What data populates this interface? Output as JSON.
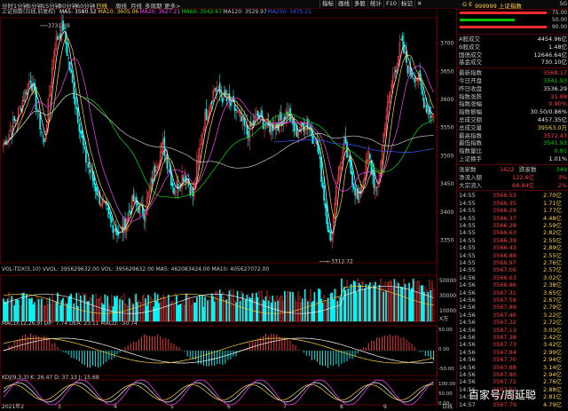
{
  "topbar": {
    "tabs": [
      "分时",
      "1分钟",
      "5分钟",
      "15分钟",
      "30分钟",
      "60分钟",
      "日线",
      "周线",
      "月线",
      "多周期",
      "更多>"
    ],
    "active_tab": "日线",
    "right_tabs": [
      "指标",
      "画线",
      "多股",
      "统计",
      "F10",
      "标记",
      "✕"
    ]
  },
  "main": {
    "title": "上证指数(日线,前复权)",
    "ma": [
      {
        "label": "MA5: 3580.52",
        "color": "#ffffff"
      },
      {
        "label": "MA10: 3605.06",
        "color": "#ffd23c"
      },
      {
        "label": "MA20: 3627.21",
        "color": "#ff40ff"
      },
      {
        "label": "MA60: 3542.67",
        "color": "#00e000"
      },
      {
        "label": "MA120: 3529.97",
        "color": "#c8c8c8"
      },
      {
        "label": "MA250: 3475.21",
        "color": "#3c5aff"
      }
    ],
    "price_ticks": [
      "3700",
      "3650",
      "3600",
      "3550",
      "3500",
      "3450",
      "3400",
      "3350"
    ],
    "high_label": "3731.69",
    "low_label": "3312.72"
  },
  "vol": {
    "header": "VOL-TDX(5,10)  VVOL: 395629632.00  VOL: 395629632.00  MA5: 462083424.00  MA10: 405627072.00",
    "ticks": [
      "50000",
      "30000",
      "10000"
    ],
    "unit": "X万"
  },
  "macd": {
    "header": "MACD(12,26,9)  DIF: 7.74  DEA: 23.11  MACD: -30.74",
    "ticks": [
      "50.00",
      "0.00",
      "-50.00"
    ]
  },
  "kdj": {
    "header": "KDJ(9,3,3)  K: 26.47  D: 37.13  J: 15.68",
    "ticks": [
      "100.00",
      "50.00",
      "0.00"
    ]
  },
  "date_axis": [
    "2021年2",
    "3",
    "4",
    "5",
    "6",
    "7",
    "8",
    "9",
    "日线"
  ],
  "right": {
    "header": "999999 上证指数",
    "code_prefix": "G E",
    "side_tag": "SG",
    "bar_values": [
      "75.00",
      "50.00",
      "90.00"
    ],
    "rows1": [
      {
        "label": "A股成交",
        "value": "4454.96亿",
        "cls": "wht"
      },
      {
        "label": "B股成交",
        "value": "1.48亿",
        "cls": "wht"
      },
      {
        "label": "国债成交",
        "value": "12646.64亿",
        "cls": "wht"
      },
      {
        "label": "基金成交",
        "value": "730.10亿",
        "cls": "wht"
      }
    ],
    "rows2": [
      {
        "label": "最新指数",
        "value": "3568.17",
        "cls": "red"
      },
      {
        "label": "今日开盘",
        "value": "3541.93",
        "cls": "grn"
      },
      {
        "label": "昨日收盘",
        "value": "3536.29",
        "cls": "wht"
      },
      {
        "label": "指数涨跌",
        "value": "31.88",
        "cls": "red"
      },
      {
        "label": "指数涨幅",
        "value": "0.90%",
        "cls": "red"
      },
      {
        "label": "指数振幅",
        "value": "30.50/0.86%",
        "cls": "wht"
      },
      {
        "label": "总成交额",
        "value": "4457.35亿",
        "cls": "wht"
      },
      {
        "label": "总成交量",
        "value": "39563.0万",
        "cls": "ylw"
      },
      {
        "label": "最高指数",
        "value": "3572.43",
        "cls": "red"
      },
      {
        "label": "最低指数",
        "value": "3541.93",
        "cls": "grn"
      },
      {
        "label": "指数量比",
        "value": "0.81",
        "cls": "grn"
      },
      {
        "label": "上证换手",
        "value": "1.01%",
        "cls": "wht"
      }
    ],
    "updown": {
      "up_label": "涨家数",
      "up": "1622",
      "down_label": "跌家数",
      "down": "349"
    },
    "flows": [
      {
        "label": "净流入额",
        "value": "122.6亿",
        "pct": "3%"
      },
      {
        "label": "大宗流入",
        "value": "68.84亿",
        "pct": "2%"
      }
    ],
    "ticks": [
      [
        "14:55",
        "3566.53",
        "2.70亿"
      ],
      [
        "14:55",
        "3566.35",
        "1.71亿"
      ],
      [
        "14:55",
        "3566.29",
        "1.77亿"
      ],
      [
        "14:55",
        "3566.37",
        "4.48亿"
      ],
      [
        "14:55",
        "3566.28",
        "2.59亿"
      ],
      [
        "14:55",
        "3566.63",
        "2.82亿"
      ],
      [
        "14:55",
        "3566.39",
        "2.55亿"
      ],
      [
        "14:55",
        "3566.43",
        "2.89亿"
      ],
      [
        "14:55",
        "3566.88",
        "2.55亿"
      ],
      [
        "14:55",
        "3566.97",
        "2.76亿"
      ],
      [
        "14:55",
        "3567.06",
        "2.57亿"
      ],
      [
        "14:56",
        "3566.63",
        "3.02亿"
      ],
      [
        "14:56",
        "3566.86",
        "2.38亿"
      ],
      [
        "14:56",
        "3567.31",
        "3.65亿"
      ],
      [
        "14:56",
        "3567.58",
        "2.67亿"
      ],
      [
        "14:56",
        "3567.89",
        "2.79亿"
      ],
      [
        "14:56",
        "3567.46",
        "3.22亿"
      ],
      [
        "14:56",
        "3567.32",
        "2.72亿"
      ],
      [
        "14:56",
        "3567.13",
        "3.03亿"
      ],
      [
        "14:56",
        "3567.38",
        "2.42亿"
      ],
      [
        "14:56",
        "3567.73",
        "3.42亿"
      ],
      [
        "14:56",
        "3567.84",
        "2.99亿"
      ],
      [
        "14:56",
        "3567.70",
        "2.94亿"
      ],
      [
        "14:56",
        "3567.88",
        "3.14亿"
      ],
      [
        "14:56",
        "3567.80",
        "2.94亿"
      ],
      [
        "14:56",
        "3567.72",
        "2.76亿"
      ],
      [
        "14:56",
        "3567.52",
        "2.88亿"
      ],
      [
        "14:56",
        "3567.55",
        "2.81亿"
      ],
      [
        "14:57",
        "3567.79",
        "4.79亿"
      ]
    ]
  },
  "watermark": "百家号/周延聪"
}
